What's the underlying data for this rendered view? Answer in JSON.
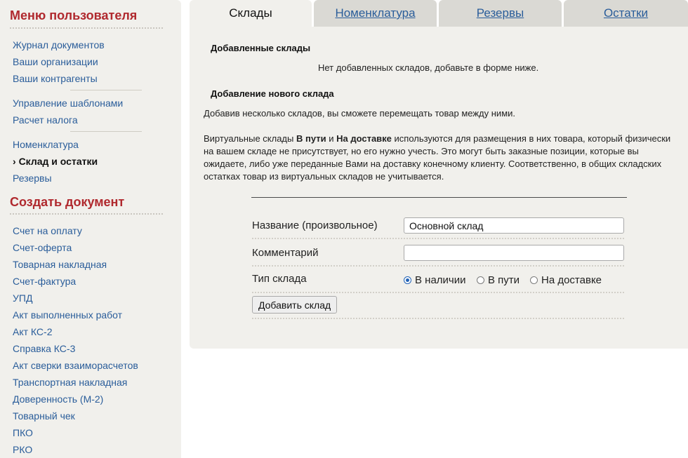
{
  "sidebar": {
    "user_menu_title": "Меню пользователя",
    "user_menu": {
      "journal": "Журнал документов",
      "organizations": "Ваши организации",
      "counterparties": "Ваши контрагенты",
      "templates": "Управление шаблонами",
      "tax": "Расчет налога",
      "nomenclature": "Номенклатура",
      "warehouse": "Склад и остатки",
      "reserves": "Резервы"
    },
    "active_prefix": "›",
    "create_title": "Создать документ",
    "create_docs": [
      "Счет на оплату",
      "Счет-оферта",
      "Товарная накладная",
      "Счет-фактура",
      "УПД",
      "Акт выполненных работ",
      "Акт КС-2",
      "Справка КС-3",
      "Акт сверки взаиморасчетов",
      "Транспортная накладная",
      "Доверенность (М-2)",
      "Товарный чек",
      "ПКО",
      "РКО"
    ]
  },
  "tabs": [
    "Склады",
    "Номенклатура",
    "Резервы",
    "Остатки"
  ],
  "active_tab": "Склады",
  "main": {
    "added_title": "Добавленные склады",
    "no_warehouses": "Нет добавленных складов, добавьте в форме ниже.",
    "new_title": "Добавление нового склада",
    "intro": "Добавив несколько складов, вы сможете перемещать товар между ними.",
    "virtual_text": {
      "p1": "Виртуальные склады ",
      "b1": "В пути",
      "p2": " и ",
      "b2": "На доставке",
      "p3": " используются для размещения в них товара, который физически на вашем складе не присутствует, но его нужно учесть. Это могут быть заказные позиции, которые вы ожидаете, либо уже переданные Вами на доставку конечному клиенту. Соответственно, в общих складских остатках товар из виртуальных складов не учитывается."
    }
  },
  "form": {
    "name_label": "Название (произвольное)",
    "name_value": "Основной склад",
    "comment_label": "Комментарий",
    "comment_value": "",
    "type_label": "Тип склада",
    "type_options": [
      "В наличии",
      "В пути",
      "На доставке"
    ],
    "type_selected": "В наличии",
    "submit_label": "Добавить склад"
  },
  "colors": {
    "accent_red": "#b0292e",
    "link_blue": "#2a5d9a",
    "panel_bg": "#f1f0ec",
    "tab_inactive_bg": "#dad9d4"
  }
}
